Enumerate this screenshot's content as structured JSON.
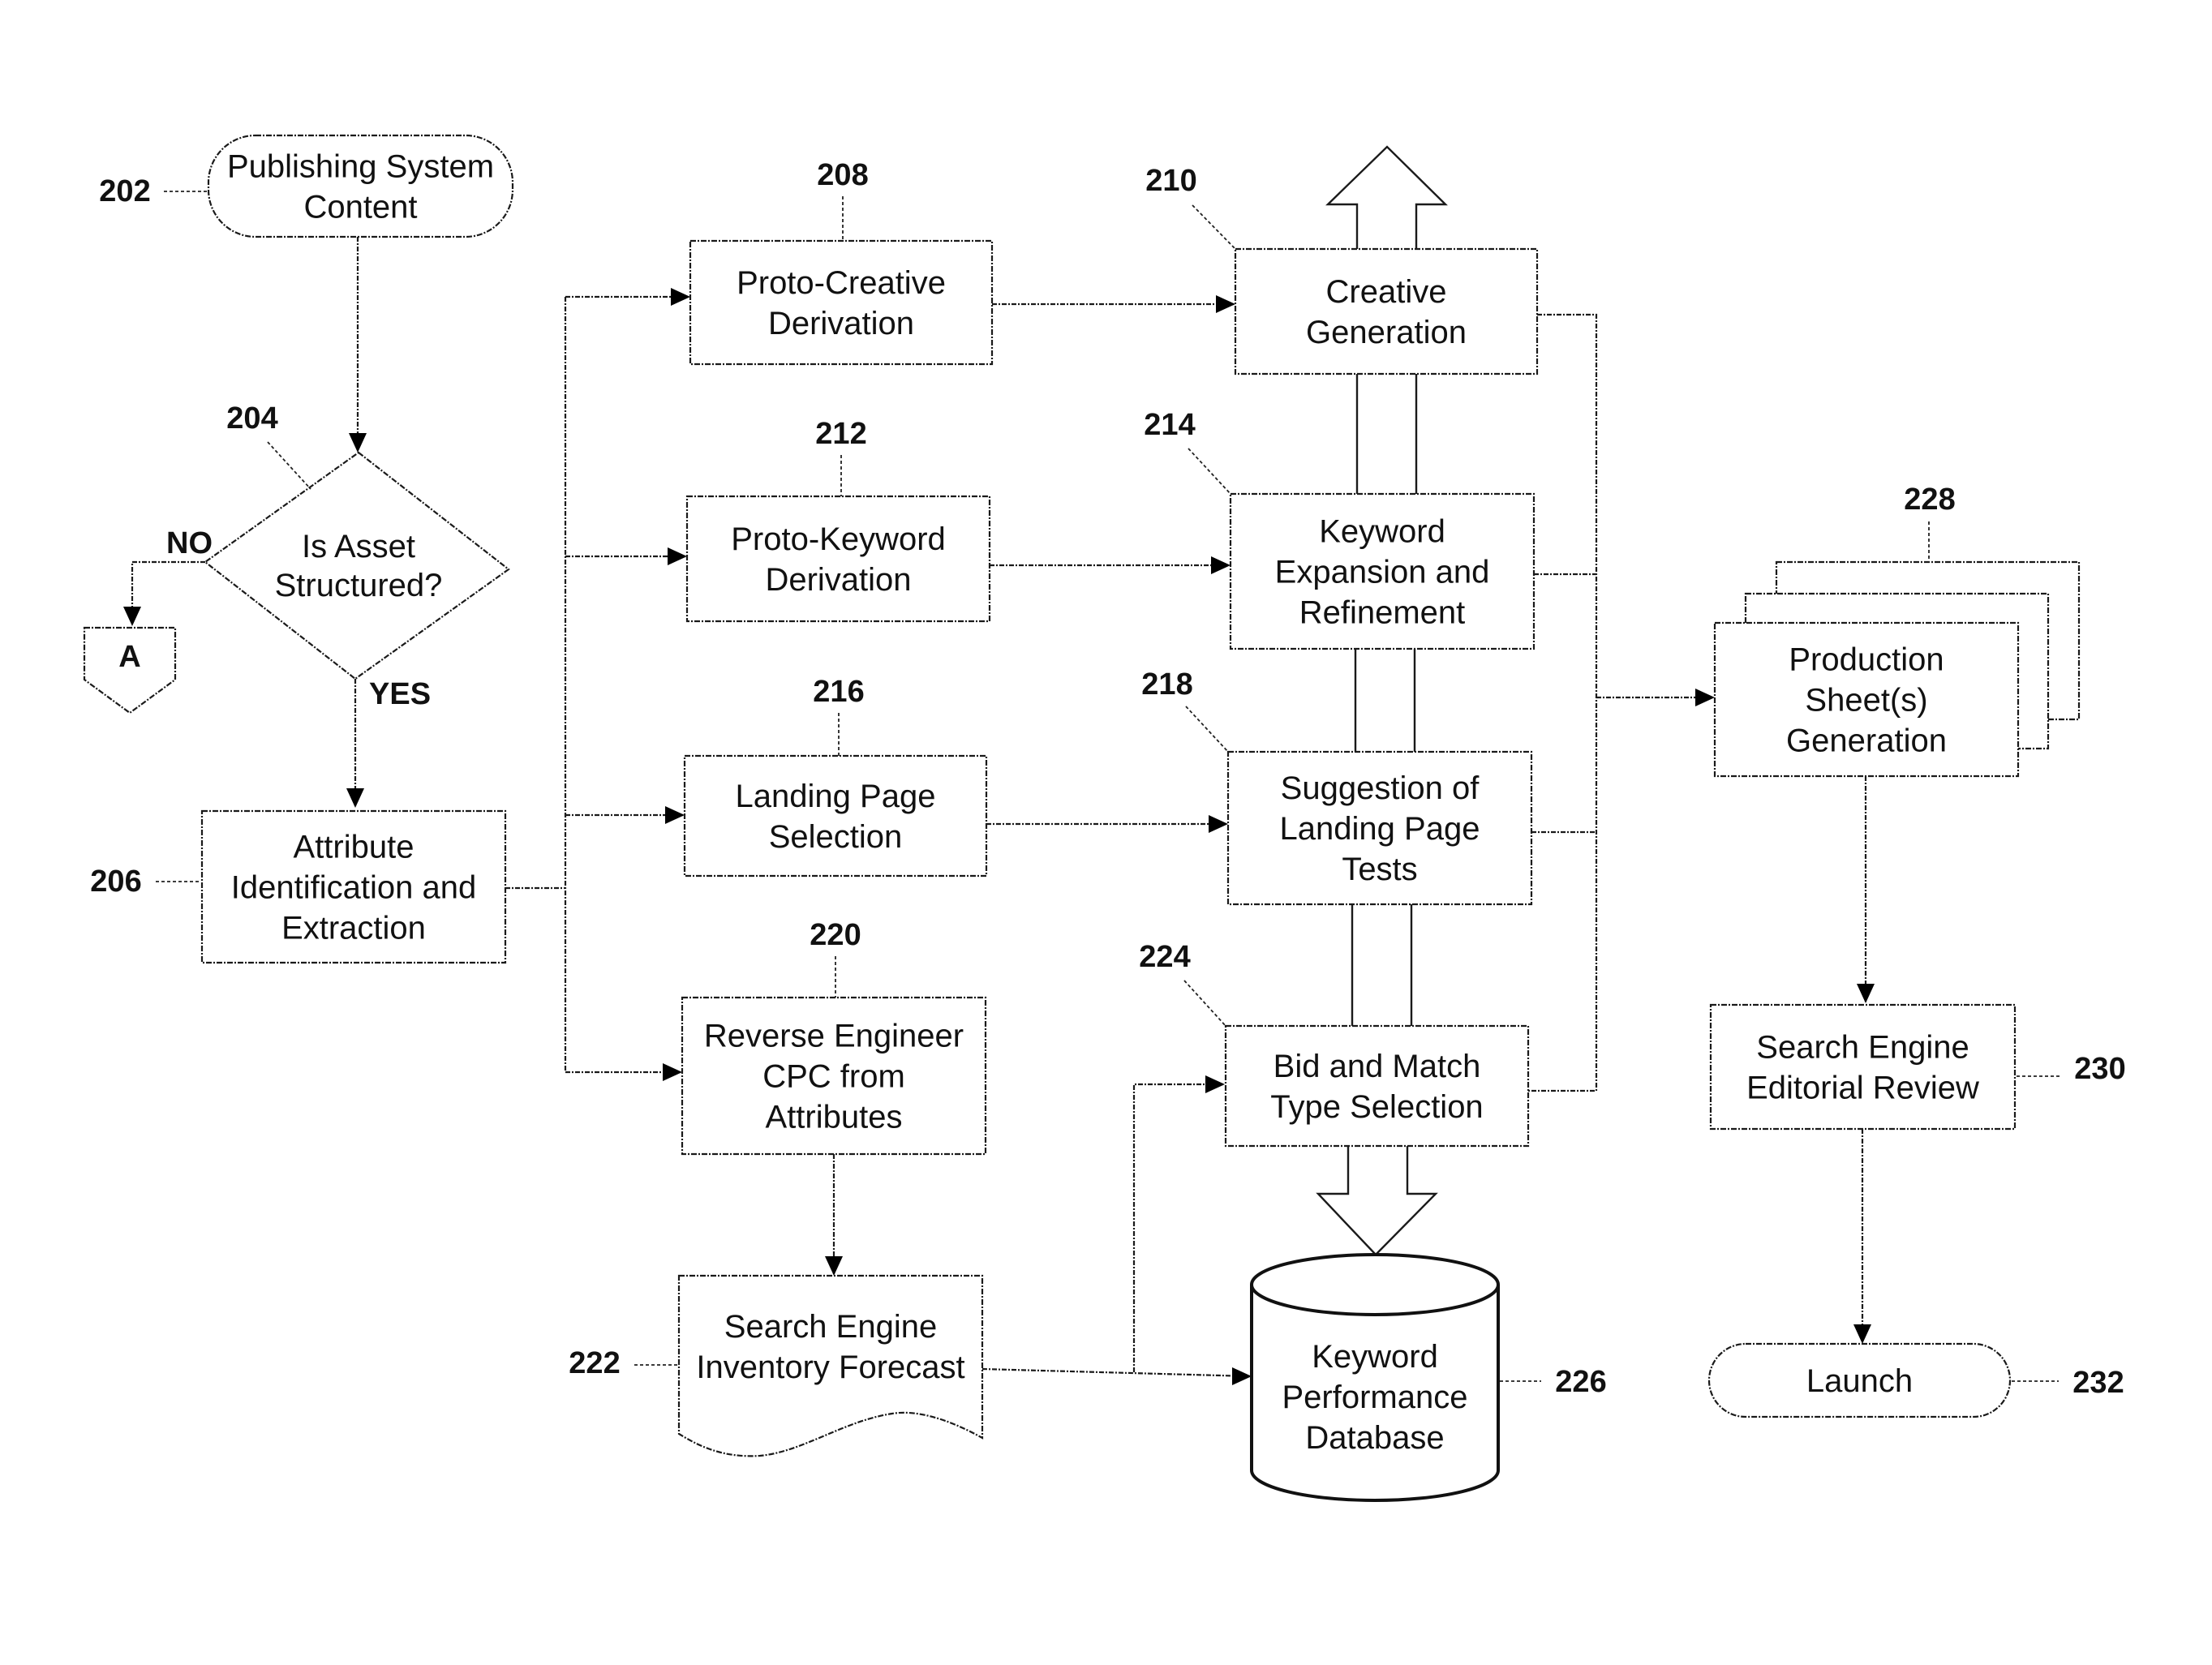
{
  "diagram": {
    "type": "flowchart",
    "nodes": {
      "n202": {
        "ref": "202",
        "shape": "terminator",
        "lines": [
          "Publishing System",
          "Content"
        ]
      },
      "n204": {
        "ref": "204",
        "shape": "decision",
        "lines": [
          "Is Asset",
          "Structured?"
        ]
      },
      "n206": {
        "ref": "206",
        "shape": "process",
        "lines": [
          "Attribute",
          "Identification and",
          "Extraction"
        ]
      },
      "n208": {
        "ref": "208",
        "shape": "process",
        "lines": [
          "Proto-Creative",
          "Derivation"
        ]
      },
      "n210": {
        "ref": "210",
        "shape": "process",
        "lines": [
          "Creative",
          "Generation"
        ]
      },
      "n212": {
        "ref": "212",
        "shape": "process",
        "lines": [
          "Proto-Keyword",
          "Derivation"
        ]
      },
      "n214": {
        "ref": "214",
        "shape": "process",
        "lines": [
          "Keyword",
          "Expansion and",
          "Refinement"
        ]
      },
      "n216": {
        "ref": "216",
        "shape": "process",
        "lines": [
          "Landing Page",
          "Selection"
        ]
      },
      "n218": {
        "ref": "218",
        "shape": "process",
        "lines": [
          "Suggestion of",
          "Landing Page",
          "Tests"
        ]
      },
      "n220": {
        "ref": "220",
        "shape": "process",
        "lines": [
          "Reverse Engineer",
          "CPC from",
          "Attributes"
        ]
      },
      "n222": {
        "ref": "222",
        "shape": "document",
        "lines": [
          "Search Engine",
          "Inventory Forecast"
        ]
      },
      "n224": {
        "ref": "224",
        "shape": "process",
        "lines": [
          "Bid and Match",
          "Type Selection"
        ]
      },
      "n226": {
        "ref": "226",
        "shape": "database",
        "lines": [
          "Keyword",
          "Performance",
          "Database"
        ]
      },
      "n228": {
        "ref": "228",
        "shape": "multi-document",
        "lines": [
          "Production",
          "Sheet(s)",
          "Generation"
        ]
      },
      "n230": {
        "ref": "230",
        "shape": "process",
        "lines": [
          "Search Engine",
          "Editorial Review"
        ]
      },
      "n232": {
        "ref": "232",
        "shape": "terminator",
        "lines": [
          "Launch"
        ]
      }
    },
    "connector": {
      "label": "A"
    },
    "branches": {
      "no": "NO",
      "yes": "YES"
    },
    "edges": [
      {
        "from": "202",
        "to": "204"
      },
      {
        "from": "204",
        "to": "A",
        "label": "NO"
      },
      {
        "from": "204",
        "to": "206",
        "label": "YES"
      },
      {
        "from": "206",
        "to": "208"
      },
      {
        "from": "206",
        "to": "212"
      },
      {
        "from": "206",
        "to": "216"
      },
      {
        "from": "206",
        "to": "220"
      },
      {
        "from": "208",
        "to": "210"
      },
      {
        "from": "212",
        "to": "214"
      },
      {
        "from": "216",
        "to": "218"
      },
      {
        "from": "220",
        "to": "222"
      },
      {
        "from": "222",
        "to": "224"
      },
      {
        "from": "222",
        "to": "226"
      },
      {
        "from": "210",
        "to": "228"
      },
      {
        "from": "214",
        "to": "228"
      },
      {
        "from": "218",
        "to": "228"
      },
      {
        "from": "224",
        "to": "228"
      },
      {
        "from": "224",
        "to": "226",
        "style": "block-arrow"
      },
      {
        "from": "210",
        "to": "up",
        "style": "block-arrow"
      },
      {
        "from": "228",
        "to": "230"
      },
      {
        "from": "230",
        "to": "232"
      }
    ]
  }
}
